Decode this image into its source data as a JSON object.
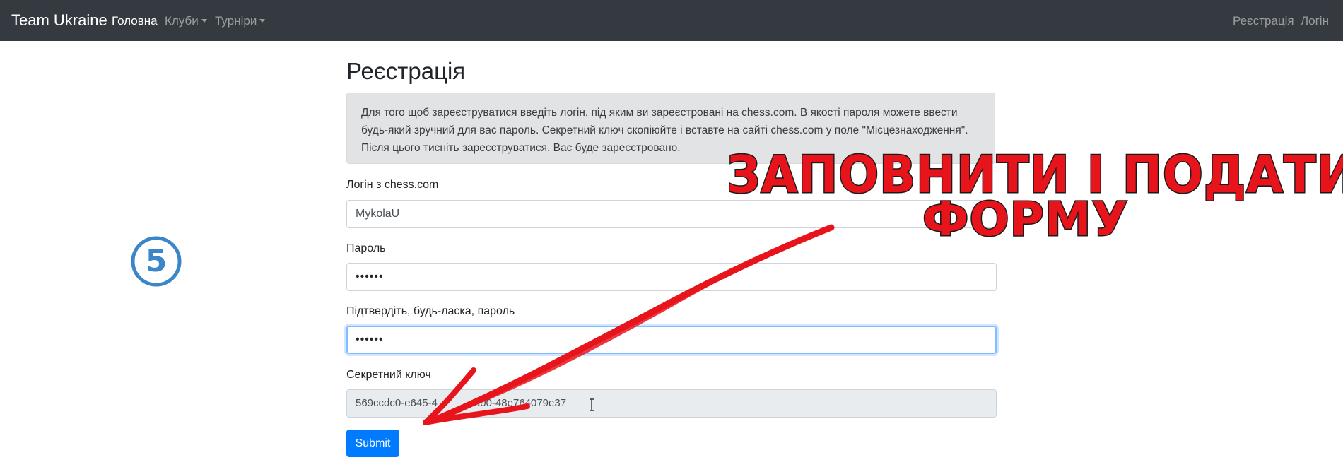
{
  "nav": {
    "brand": "Team Ukraine",
    "home": "Головна",
    "clubs": "Клуби",
    "tournaments": "Турніри",
    "register": "Реєстрація",
    "login": "Логін"
  },
  "page": {
    "title": "Реєстрація"
  },
  "info": {
    "line1": "Для того щоб зареєструватися введіть логін, під яким ви зареєстровані на chess.com. В якості пароля можете ввести",
    "line2": "будь-який зручний для вас пароль. Секретний ключ скопіюйте і вставте на сайті chess.com у поле \"Місцезнаходження\".",
    "line3": "Після цього тисніть зареєструватися. Вас буде зареєстровано."
  },
  "form": {
    "login_label": "Логін з chess.com",
    "login_value": "MykolaU",
    "password_label": "Пароль",
    "password_value": "••••••",
    "confirm_label": "Підтвердіть, будь-ласка, пароль",
    "confirm_value": "••••••",
    "secret_label": "Секретний ключ",
    "secret_value": "569ccdc0-e645-4",
    "secret_value_tail": "d00-48e764079e37",
    "submit_label": "Submit"
  },
  "annotation": {
    "step_number": "5",
    "line1": "ЗАПОВНИТИ І ПОДАТИ",
    "line2": "ФОРМУ"
  },
  "colors": {
    "navbar_bg": "#343a40",
    "primary": "#007bff",
    "annotation_red": "#e8141b",
    "step_badge_blue": "#3a86c8"
  }
}
